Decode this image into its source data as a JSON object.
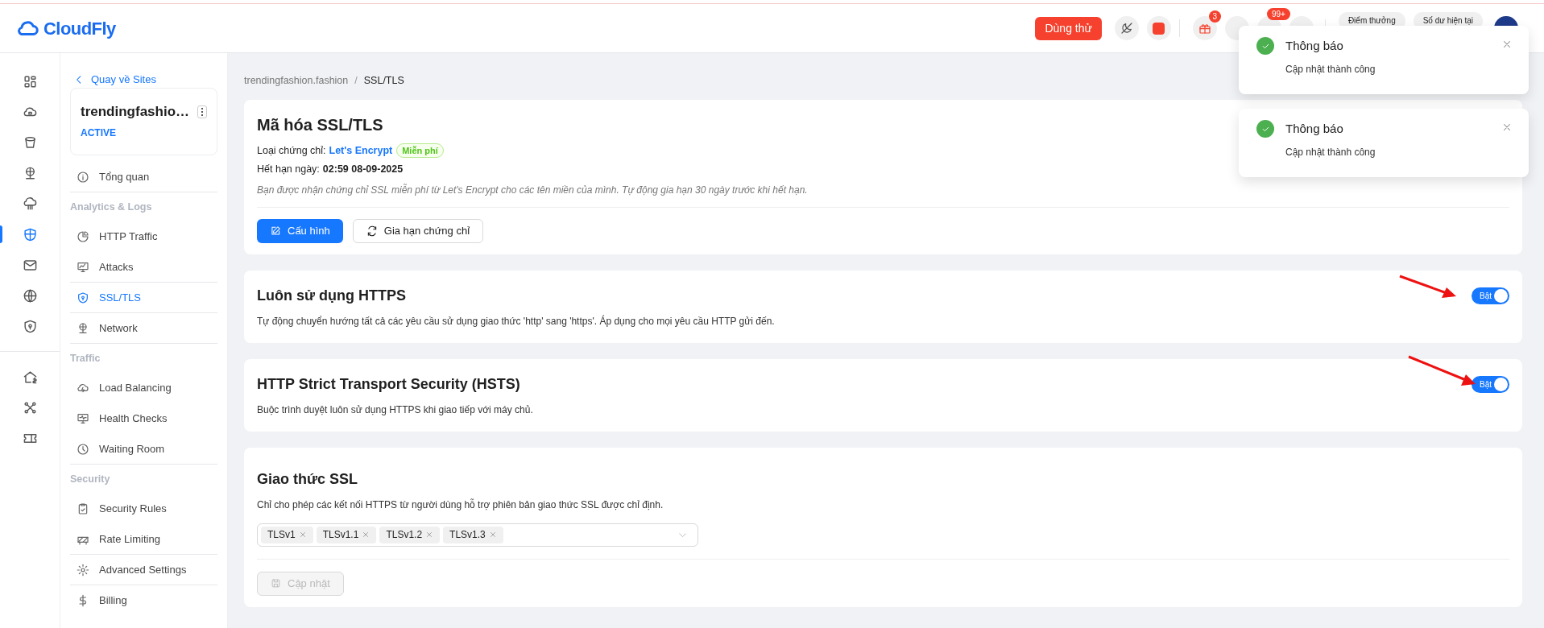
{
  "header": {
    "logo": "CloudFly",
    "trial_button": "Dùng thử",
    "gift_badge": "3",
    "notification_badge": "99+",
    "pills": [
      "Điểm thưởng",
      "Số dư hiện tại"
    ]
  },
  "rail": {
    "groups": [
      [
        {
          "selected": false
        },
        {
          "selected": false
        },
        {
          "selected": false
        },
        {
          "selected": false
        },
        {
          "selected": false
        },
        {
          "selected": true
        },
        {
          "selected": false
        },
        {
          "selected": false
        },
        {
          "selected": false
        }
      ],
      [
        {
          "selected": false
        },
        {
          "selected": false
        },
        {
          "selected": false
        }
      ]
    ]
  },
  "sidebar": {
    "back_link": "Quay về Sites",
    "site": {
      "name": "trendingfashio…",
      "status": "ACTIVE"
    },
    "nav": [
      {
        "kind": "link",
        "label": "Tổng quan",
        "selected": false,
        "divider": true
      },
      {
        "kind": "heading",
        "label": "Analytics & Logs"
      },
      {
        "kind": "link",
        "label": "HTTP Traffic",
        "selected": false,
        "divider": false
      },
      {
        "kind": "link",
        "label": "Attacks",
        "selected": false,
        "divider": true
      },
      {
        "kind": "link",
        "label": "SSL/TLS",
        "selected": true,
        "divider": true
      },
      {
        "kind": "link",
        "label": "Network",
        "selected": false,
        "divider": true
      },
      {
        "kind": "heading",
        "label": "Traffic"
      },
      {
        "kind": "link",
        "label": "Load Balancing",
        "selected": false,
        "divider": false
      },
      {
        "kind": "link",
        "label": "Health Checks",
        "selected": false,
        "divider": false
      },
      {
        "kind": "link",
        "label": "Waiting Room",
        "selected": false,
        "divider": true
      },
      {
        "kind": "heading",
        "label": "Security"
      },
      {
        "kind": "link",
        "label": "Security Rules",
        "selected": false,
        "divider": false
      },
      {
        "kind": "link",
        "label": "Rate Limiting",
        "selected": false,
        "divider": true
      },
      {
        "kind": "link",
        "label": "Advanced Settings",
        "selected": false,
        "divider": true
      },
      {
        "kind": "link",
        "label": "Billing",
        "selected": false,
        "divider": false
      }
    ]
  },
  "breadcrumb_separator": "/",
  "breadcrumb": [
    {
      "label": "trendingfashion.fashion",
      "current": false
    },
    {
      "label": "SSL/TLS",
      "current": true
    }
  ],
  "ssl_card": {
    "title": "Mã hóa SSL/TLS",
    "cert_label": "Loại chứng chỉ:",
    "cert_value": "Let's Encrypt",
    "cert_tag": "Miễn phí",
    "expiry_label": "Hết hạn ngày:",
    "expiry_value": "02:59 08-09-2025",
    "note": "Bạn được nhận chứng chỉ SSL miễn phí từ Let's Encrypt cho các tên miền của mình. Tự động gia hạn 30 ngày trước khi hết hạn.",
    "buttons": [
      {
        "kind": "primary",
        "label": "Cấu hình"
      },
      {
        "kind": "default",
        "label": "Gia hạn chứng chỉ"
      }
    ]
  },
  "settings": [
    {
      "title": "Luôn sử dụng HTTPS",
      "description": "Tự động chuyển hướng tất cả các yêu cầu sử dụng giao thức 'http' sang 'https'. Áp dụng cho mọi yêu cầu HTTP gửi đến.",
      "toggle": {
        "label": "Bật",
        "on": true
      }
    },
    {
      "title": "HTTP Strict Transport Security (HSTS)",
      "description": "Buộc trình duyệt luôn sử dụng HTTPS khi giao tiếp với máy chủ.",
      "toggle": {
        "label": "Bật",
        "on": true
      }
    }
  ],
  "protocol_card": {
    "title": "Giao thức SSL",
    "description": "Chỉ cho phép các kết nối HTTPS từ người dùng hỗ trợ phiên bản giao thức SSL được chỉ định.",
    "selected_versions": [
      "TLSv1",
      "TLSv1.1",
      "TLSv1.2",
      "TLSv1.3"
    ],
    "save_button": {
      "label": "Cập nhật",
      "disabled": true
    }
  },
  "toasts": [
    {
      "title": "Thông báo",
      "message": "Cập nhật thành công"
    },
    {
      "title": "Thông báo",
      "message": "Cập nhật thành công"
    }
  ]
}
